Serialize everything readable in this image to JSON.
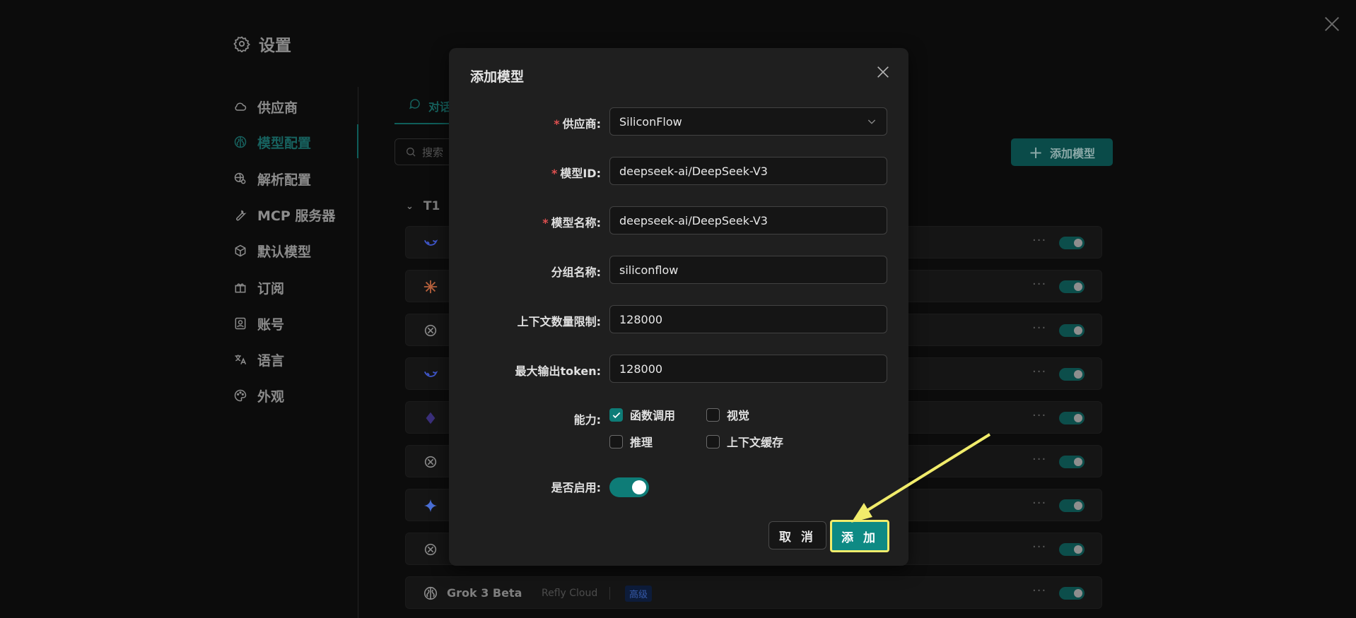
{
  "settings": {
    "title": "设置"
  },
  "sidebar": {
    "items": [
      {
        "label": "供应商",
        "icon": "cloud-icon"
      },
      {
        "label": "模型配置",
        "icon": "brain-icon",
        "active": true
      },
      {
        "label": "解析配置",
        "icon": "globe-gear-icon"
      },
      {
        "label": "MCP 服务器",
        "icon": "wrench-icon"
      },
      {
        "label": "默认模型",
        "icon": "cube-icon"
      },
      {
        "label": "订阅",
        "icon": "gift-icon"
      },
      {
        "label": "账号",
        "icon": "user-card-icon"
      },
      {
        "label": "语言",
        "icon": "translate-icon"
      },
      {
        "label": "外观",
        "icon": "palette-icon"
      }
    ]
  },
  "main": {
    "tab_label": "对话",
    "search_placeholder": "搜索",
    "add_model_label": "添加模型",
    "group_name": "T1",
    "last_row": {
      "name": "Grok 3 Beta",
      "provider": "Refly Cloud",
      "badge": "高级"
    }
  },
  "modal": {
    "title": "添加模型",
    "fields": {
      "provider": {
        "label": "供应商",
        "value": "SiliconFlow"
      },
      "model_id": {
        "label": "模型ID",
        "value": "deepseek-ai/DeepSeek-V3"
      },
      "model_name": {
        "label": "模型名称",
        "value": "deepseek-ai/DeepSeek-V3"
      },
      "group_name": {
        "label": "分组名称",
        "value": "siliconflow"
      },
      "context_limit": {
        "label": "上下文数量限制",
        "value": "128000"
      },
      "max_output": {
        "label": "最大输出token",
        "value": "128000"
      }
    },
    "capabilities": {
      "label": "能力",
      "function_call": {
        "label": "函数调用",
        "checked": true
      },
      "vision": {
        "label": "视觉",
        "checked": false
      },
      "reasoning": {
        "label": "推理",
        "checked": false
      },
      "context_cache": {
        "label": "上下文缓存",
        "checked": false
      }
    },
    "enabled": {
      "label": "是否启用",
      "value": true
    },
    "cancel_label": "取 消",
    "add_label": "添 加"
  },
  "colors": {
    "accent": "#0e8a84",
    "highlight": "#f1ec6b"
  }
}
